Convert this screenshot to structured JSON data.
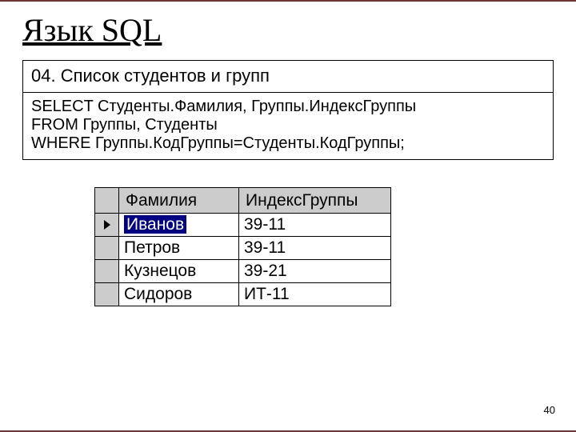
{
  "title": "Язык SQL",
  "query": {
    "caption": "04. Список студентов и групп",
    "sql_line1_kw": "SELECT",
    "sql_line1_rest": " Студенты.Фамилия, Группы.ИндексГруппы",
    "sql_line2_kw": "FROM",
    "sql_line2_rest": " Группы, Студенты",
    "sql_line3_kw": "WHERE",
    "sql_line3_rest": " Группы.КодГруппы=Студенты.КодГруппы;"
  },
  "table": {
    "headers": {
      "surname": "Фамилия",
      "group": "ИндексГруппы"
    },
    "rows": [
      {
        "surname": "Иванов",
        "group": "39-11",
        "current": true,
        "selected": true
      },
      {
        "surname": "Петров",
        "group": "39-11",
        "current": false,
        "selected": false
      },
      {
        "surname": "Кузнецов",
        "group": "39-21",
        "current": false,
        "selected": false
      },
      {
        "surname": "Сидоров",
        "group": "ИТ-11",
        "current": false,
        "selected": false
      }
    ]
  },
  "pageNumber": "40"
}
